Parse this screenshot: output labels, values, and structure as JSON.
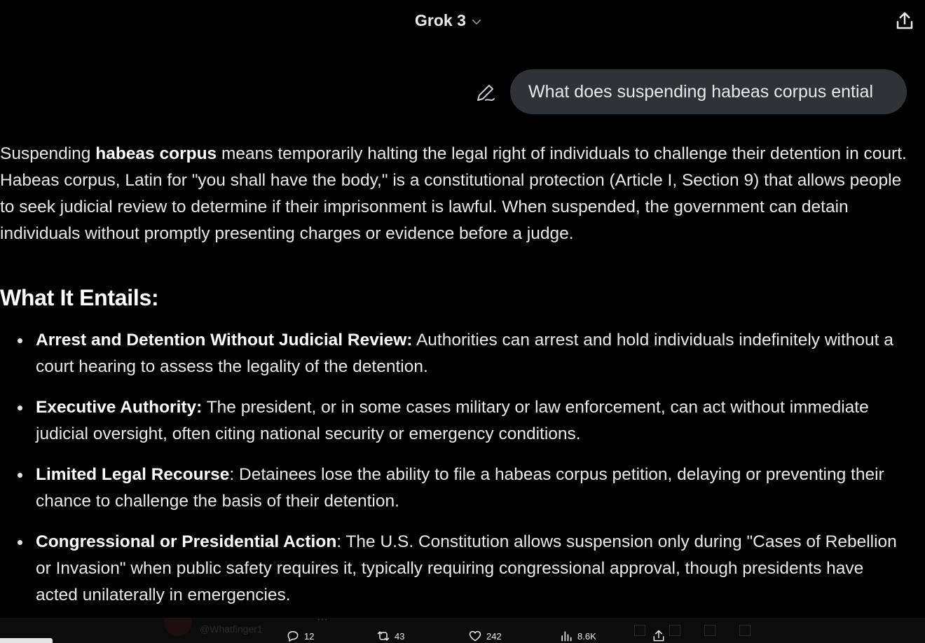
{
  "header": {
    "model_label": "Grok 3",
    "model_dropdown_icon": "chevron-down-icon",
    "share_icon": "share-upload-icon"
  },
  "user_message": {
    "text": "What does suspending habeas corpus ential",
    "edit_icon": "edit-pen-icon"
  },
  "answer": {
    "intro": {
      "pre": "Suspending ",
      "bold": "habeas corpus",
      "post": " means temporarily halting the legal right of individuals to challenge their detention in court. Habeas corpus, Latin for \"you shall have the body,\" is a constitutional protection (Article I, Section 9) that allows people to seek judicial review to determine if their imprisonment is lawful. When suspended, the government can detain individuals without promptly presenting charges or evidence before a judge."
    },
    "heading": "What It Entails:",
    "points": [
      {
        "title": "Arrest and Detention Without Judicial Review:",
        "text": " Authorities can arrest and hold individuals indefinitely without a court hearing to assess the legality of the detention."
      },
      {
        "title": "Executive Authority:",
        "text": " The president, or in some cases military or law enforcement, can act without immediate judicial oversight, often citing national security or emergency conditions."
      },
      {
        "title": "Limited Legal Recourse",
        "text": ": Detainees lose the ability to file a habeas corpus petition, delaying or preventing their chance to challenge the basis of their detention."
      },
      {
        "title": "Congressional or Presidential Action",
        "text": ": The U.S. Constitution allows suspension only during \"Cases of Rebellion or Invasion\" when public safety requires it, typically requiring congressional approval, though presidents have acted unilaterally in emergencies."
      }
    ]
  },
  "footer": {
    "ghost_handle": "@Whatfinger1",
    "replies": "12",
    "reposts": "43",
    "likes": "242",
    "views": "8.6K"
  },
  "colors": {
    "background": "#000000",
    "text": "#e7e9ea",
    "bubble": "#2f3336"
  }
}
